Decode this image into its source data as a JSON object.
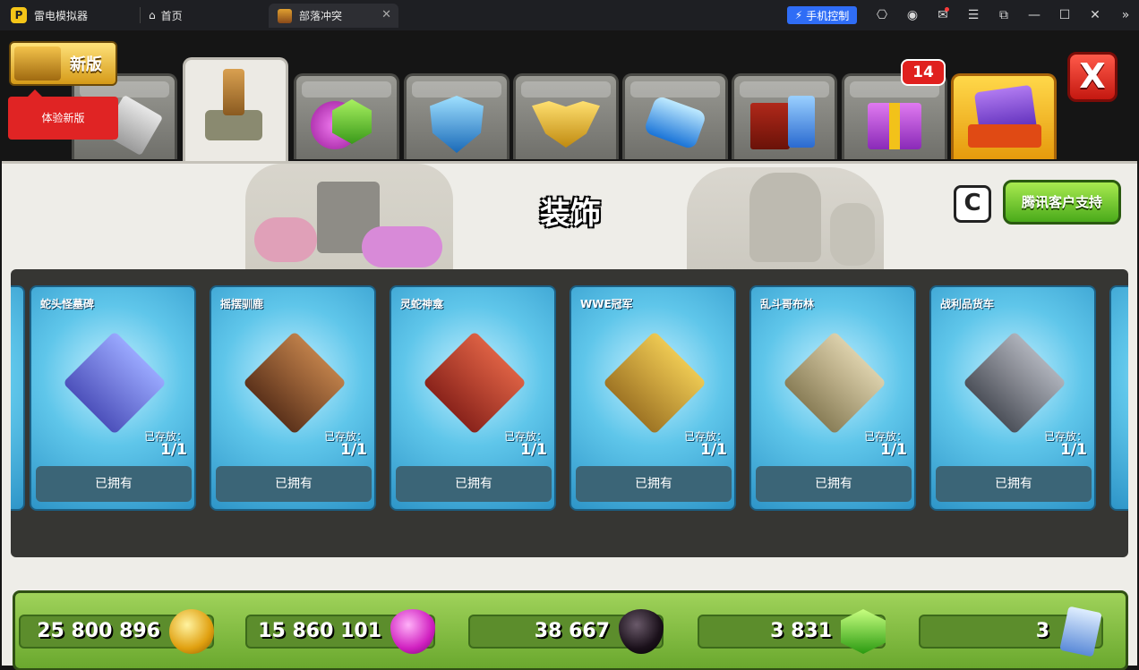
{
  "titlebar": {
    "app_name": "雷电模拟器",
    "home_label": "首页",
    "tab_label": "部落冲突",
    "phone_label": "手机控制"
  },
  "new_version": {
    "label": "新版",
    "tip": "体验新版"
  },
  "tabs": {
    "badge": "14",
    "items": [
      {
        "name": "builder-tools",
        "icon": "hammer-icon"
      },
      {
        "name": "decorations",
        "icon": "statue-icon"
      },
      {
        "name": "resources",
        "icon": "gem-icon"
      },
      {
        "name": "shields",
        "icon": "shield-icon"
      },
      {
        "name": "badges",
        "icon": "badge-icon"
      },
      {
        "name": "magic",
        "icon": "crystal-icon"
      },
      {
        "name": "books",
        "icon": "book-icon"
      },
      {
        "name": "gifts",
        "icon": "gift-icon"
      },
      {
        "name": "cards",
        "icon": "card-icon"
      }
    ]
  },
  "close_label": "X",
  "page": {
    "title": "装饰",
    "c_label": "C",
    "support_label": "腾讯客户支持"
  },
  "cards": [
    {
      "title": "蛇头怪墓碑",
      "stored": "已存放：",
      "count": "1/1",
      "owned": "已拥有",
      "color": "#6a7fd8"
    },
    {
      "title": "摇摆驯鹿",
      "stored": "已存放：",
      "count": "1/1",
      "owned": "已拥有",
      "color": "#8a4a24"
    },
    {
      "title": "灵蛇神龛",
      "stored": "已存放：",
      "count": "1/1",
      "owned": "已拥有",
      "color": "#c03a2a"
    },
    {
      "title": "WWE冠军",
      "stored": "已存放：",
      "count": "1/1",
      "owned": "已拥有",
      "color": "#d4a020"
    },
    {
      "title": "乱斗哥布林",
      "stored": "已存放：",
      "count": "1/1",
      "owned": "已拥有",
      "color": "#b8a070"
    },
    {
      "title": "战利品货车",
      "stored": "已存放：",
      "count": "1/1",
      "owned": "已拥有",
      "color": "#7a7a80"
    }
  ],
  "resources": [
    {
      "value": "25 800 896",
      "icon": "gold-coin-icon",
      "color": "#f2c21a"
    },
    {
      "value": "15 860 101",
      "icon": "elixir-drop-icon",
      "color": "#e030c8"
    },
    {
      "value": "38 667",
      "icon": "dark-elixir-icon",
      "color": "#2a1e2a"
    },
    {
      "value": "3 831",
      "icon": "gem-icon",
      "color": "#52d42a"
    },
    {
      "value": "3",
      "icon": "ticket-icon",
      "color": "#8ab4e8"
    }
  ]
}
